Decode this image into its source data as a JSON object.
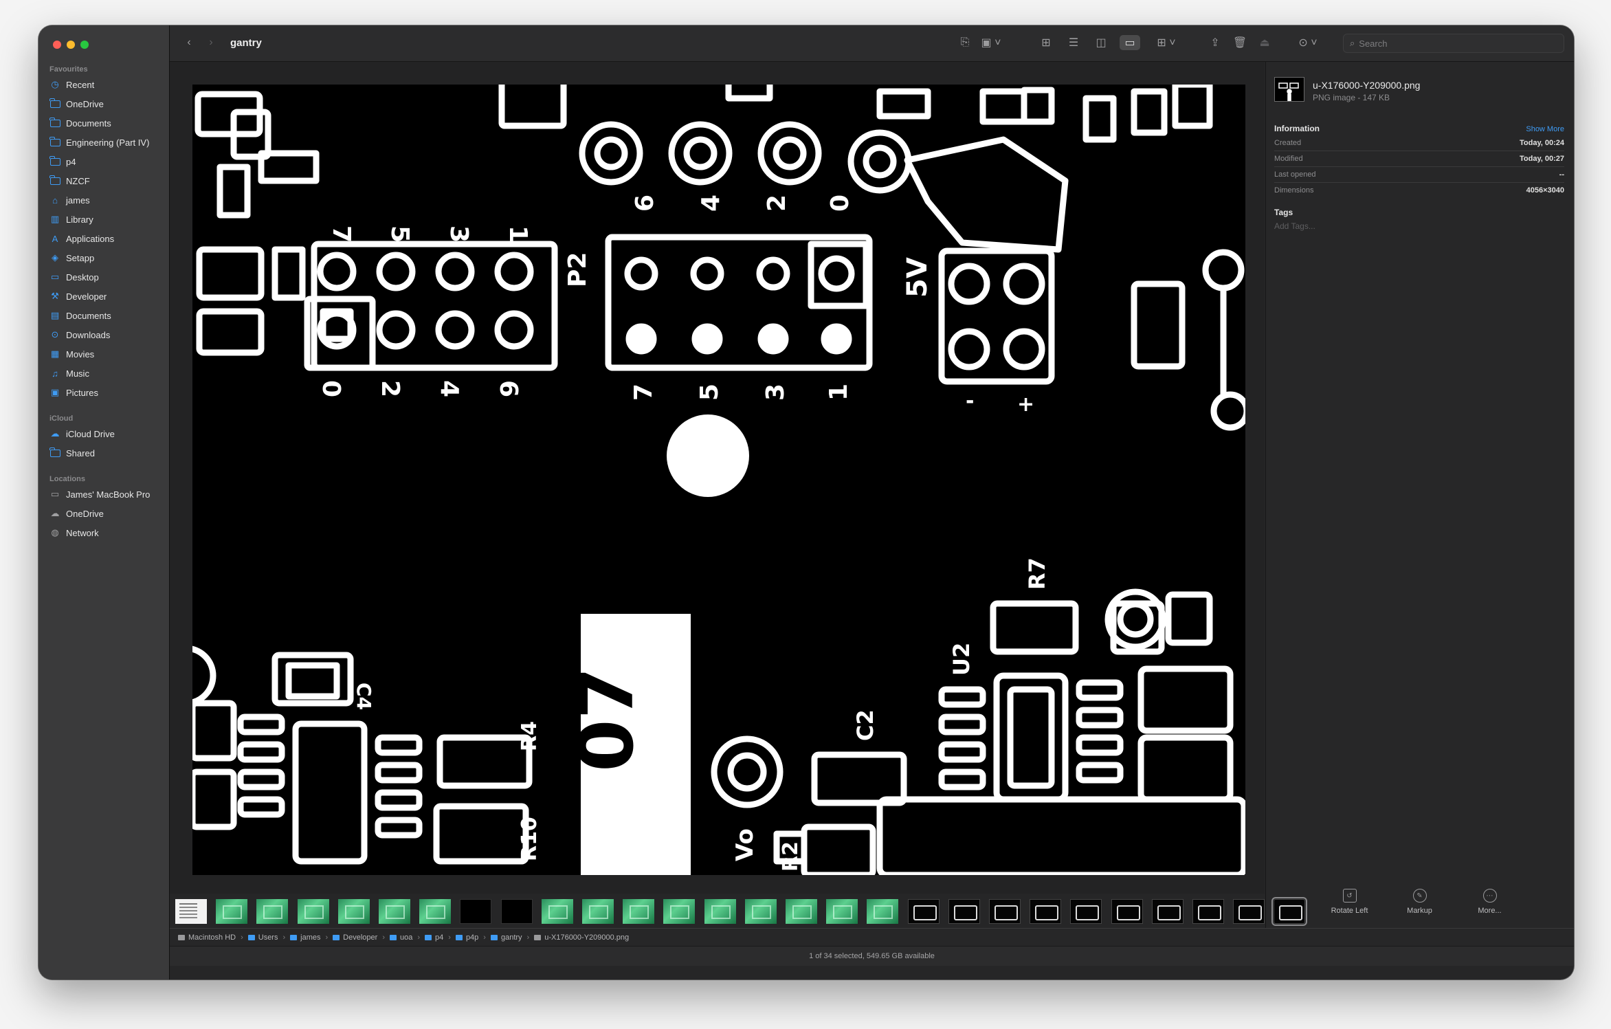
{
  "window": {
    "folder_title": "gantry"
  },
  "sidebar": {
    "sections": [
      {
        "label": "Favourites",
        "items": [
          {
            "label": "Recent",
            "icon": "clock-icon"
          },
          {
            "label": "OneDrive",
            "icon": "folder-icon"
          },
          {
            "label": "Documents",
            "icon": "folder-icon"
          },
          {
            "label": "Engineering (Part IV)",
            "icon": "folder-icon"
          },
          {
            "label": "p4",
            "icon": "folder-icon"
          },
          {
            "label": "NZCF",
            "icon": "folder-icon"
          },
          {
            "label": "james",
            "icon": "house-icon"
          },
          {
            "label": "Library",
            "icon": "building-icon"
          },
          {
            "label": "Applications",
            "icon": "applications-icon"
          },
          {
            "label": "Setapp",
            "icon": "setapp-icon"
          },
          {
            "label": "Desktop",
            "icon": "desktop-icon"
          },
          {
            "label": "Developer",
            "icon": "hammer-icon"
          },
          {
            "label": "Documents",
            "icon": "document-icon"
          },
          {
            "label": "Downloads",
            "icon": "download-icon"
          },
          {
            "label": "Movies",
            "icon": "film-icon"
          },
          {
            "label": "Music",
            "icon": "music-note-icon"
          },
          {
            "label": "Pictures",
            "icon": "photo-icon"
          }
        ]
      },
      {
        "label": "iCloud",
        "items": [
          {
            "label": "iCloud Drive",
            "icon": "cloud-icon"
          },
          {
            "label": "Shared",
            "icon": "shared-folder-icon"
          }
        ]
      },
      {
        "label": "Locations",
        "items": [
          {
            "label": "James' MacBook Pro",
            "icon": "laptop-icon"
          },
          {
            "label": "OneDrive",
            "icon": "cloud-icon"
          },
          {
            "label": "Network",
            "icon": "globe-icon"
          }
        ]
      }
    ]
  },
  "toolbar": {
    "search_placeholder": "Search"
  },
  "preview": {
    "image_labels": {
      "header_top": [
        "7",
        "5",
        "3",
        "1"
      ],
      "header_bottom": [
        "0",
        "2",
        "4",
        "6"
      ],
      "header2_top": [
        "6",
        "4",
        "2",
        "0"
      ],
      "header2_bottom": [
        "7",
        "5",
        "3",
        "1"
      ],
      "p2": "P2",
      "fivev": "5V",
      "r7": "R7",
      "u2": "U2",
      "c2": "C2",
      "c4": "C4",
      "r4": "R4",
      "r10": "R10",
      "vo": "Vo",
      "big_text": "07",
      "minus": "-",
      "plus": "+",
      "r2": "R2"
    }
  },
  "info": {
    "file_name": "u-X176000-Y209000.png",
    "file_kind": "PNG image - 147 KB",
    "information_heading": "Information",
    "show_more": "Show More",
    "rows": [
      {
        "key": "Created",
        "value": "Today, 00:24"
      },
      {
        "key": "Modified",
        "value": "Today, 00:27"
      },
      {
        "key": "Last opened",
        "value": "--"
      },
      {
        "key": "Dimensions",
        "value": "4056×3040"
      }
    ],
    "tags_heading": "Tags",
    "tags_placeholder": "Add Tags..."
  },
  "actions": [
    {
      "label": "Rotate Left",
      "icon": "rotate-left-icon"
    },
    {
      "label": "Markup",
      "icon": "markup-icon"
    },
    {
      "label": "More...",
      "icon": "more-icon"
    }
  ],
  "filmstrip": {
    "thumbs": [
      "white",
      "green",
      "green",
      "green",
      "green",
      "green",
      "green",
      "black",
      "black",
      "green",
      "green",
      "green",
      "green",
      "green",
      "green",
      "green",
      "green",
      "green",
      "bw",
      "bw",
      "bw",
      "bw",
      "bw",
      "bw",
      "bw",
      "bw",
      "bw",
      "sel"
    ],
    "selected_index": 27
  },
  "pathbar": {
    "crumbs": [
      "Macintosh HD",
      "Users",
      "james",
      "Developer",
      "uoa",
      "p4",
      "p4p",
      "gantry",
      "u-X176000-Y209000.png"
    ]
  },
  "status": {
    "text": "1 of 34 selected, 549.65 GB available"
  }
}
